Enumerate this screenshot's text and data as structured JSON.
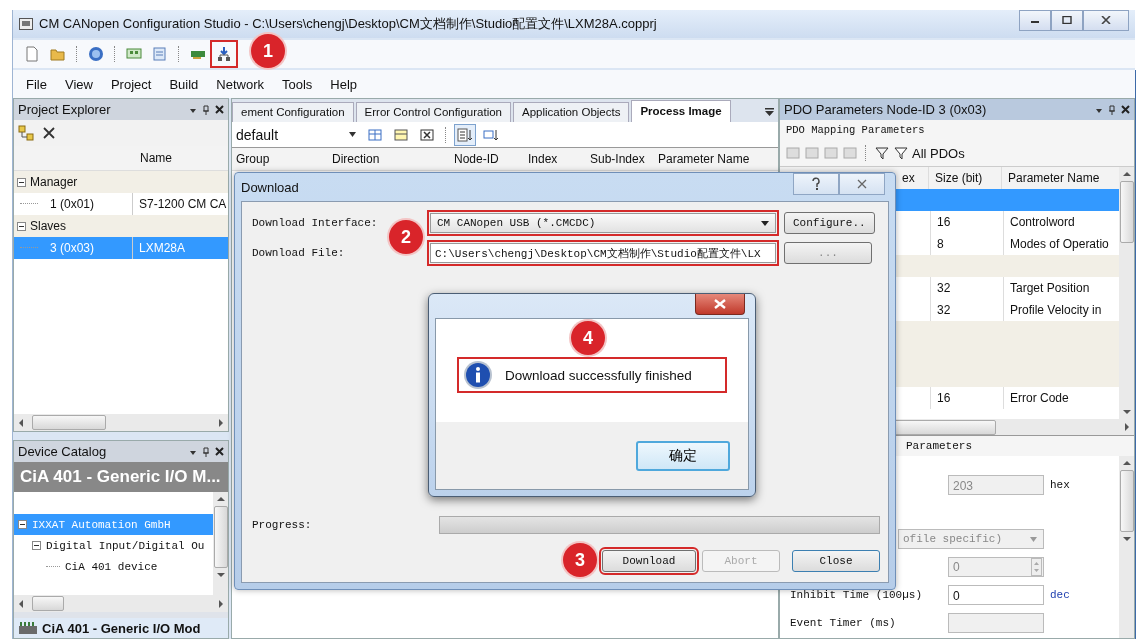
{
  "window": {
    "title": "CM CANopen Configuration Studio - C:\\Users\\chengj\\Desktop\\CM文档制作\\Studio配置文件\\LXM28A.copprj"
  },
  "menu": [
    "File",
    "View",
    "Project",
    "Build",
    "Network",
    "Tools",
    "Help"
  ],
  "project_explorer": {
    "title": "Project Explorer",
    "column": "Name",
    "tree": [
      {
        "label": "Manager",
        "expanded": true,
        "children": [
          {
            "label": "1 (0x01)",
            "name": "S7-1200 CM CA",
            "selected": false
          }
        ]
      },
      {
        "label": "Slaves",
        "expanded": true,
        "children": [
          {
            "label": "3 (0x03)",
            "name": "LXM28A",
            "selected": true
          }
        ]
      }
    ]
  },
  "device_catalog": {
    "title": "Device Catalog",
    "banner": "CiA 401 - Generic I/O M...",
    "tree": [
      {
        "label": "IXXAT Automation GmbH",
        "expanded": true,
        "selected": true,
        "children": [
          {
            "label": "Digital Input/Digital Ou",
            "expanded": true,
            "selected": false,
            "children": [
              {
                "label": "CiA 401 device",
                "selected": false
              }
            ]
          }
        ]
      }
    ],
    "footer": "CiA 401 - Generic I/O Mod"
  },
  "center": {
    "tabs": [
      {
        "label": "ement Configuration",
        "selected": false
      },
      {
        "label": "Error Control Configuration",
        "selected": false
      },
      {
        "label": "Application Objects",
        "selected": false
      },
      {
        "label": "Process Image",
        "selected": true
      }
    ],
    "filter": {
      "value": "default"
    },
    "columns": [
      "Group",
      "Direction",
      "Node-ID",
      "Index",
      "Sub-Index",
      "Parameter Name"
    ]
  },
  "pdo_panel": {
    "title": "PDO Parameters Node-ID 3 (0x03)",
    "subtitle": "PDO Mapping Parameters",
    "filter_label": "All PDOs",
    "columns": [
      "ex",
      "Size (bit)",
      "Parameter Name"
    ],
    "rows": [
      {
        "kind": "group",
        "selected": true
      },
      {
        "kind": "entry",
        "size": "16",
        "name": "Controlword",
        "selected": false
      },
      {
        "kind": "entry",
        "size": "8",
        "name": "Modes of Operatio",
        "selected": false
      },
      {
        "kind": "group",
        "selected": false
      },
      {
        "kind": "entry",
        "size": "32",
        "name": "Target Position",
        "selected": false
      },
      {
        "kind": "entry",
        "size": "32",
        "name": "Profile Velocity in",
        "selected": false
      },
      {
        "kind": "group",
        "selected": false
      },
      {
        "kind": "group",
        "selected": false
      },
      {
        "kind": "group",
        "selected": false
      },
      {
        "kind": "entry",
        "size": "16",
        "name": "Error Code",
        "selected": false
      }
    ]
  },
  "pdo_properties": {
    "title": "Parameters",
    "fields": [
      {
        "kind": "text",
        "value": "203",
        "unit": "hex",
        "disabled": true
      },
      {
        "kind": "combo",
        "value": "ofile specific)",
        "disabled": true
      },
      {
        "kind": "spin",
        "value": "0",
        "disabled": true
      },
      {
        "kind": "text",
        "label": "Inhibit Time (100µs)",
        "value": "0",
        "unit": "dec",
        "disabled": false
      },
      {
        "kind": "text",
        "label": "Event Timer (ms)",
        "disabled": true
      }
    ]
  },
  "download_dialog": {
    "title": "Download",
    "interface": {
      "label": "Download Interface:",
      "value": "CM CANopen USB (*.CMCDC)"
    },
    "file": {
      "label": "Download File:",
      "value": "C:\\Users\\chengj\\Desktop\\CM文档制作\\Studio配置文件\\LX"
    },
    "configure_button": "Configure..",
    "browse_button": "...",
    "progress": {
      "label": "Progress:",
      "level": 0
    },
    "buttons": [
      {
        "label": "Download",
        "disabled": false
      },
      {
        "label": "Abort",
        "disabled": true
      },
      {
        "label": "Close",
        "disabled": false
      }
    ]
  },
  "message_box": {
    "text": "Download successfully finished",
    "ok_button": "确定"
  },
  "annotations": [
    {
      "number": "1"
    },
    {
      "number": "2"
    },
    {
      "number": "3"
    },
    {
      "number": "4"
    }
  ]
}
